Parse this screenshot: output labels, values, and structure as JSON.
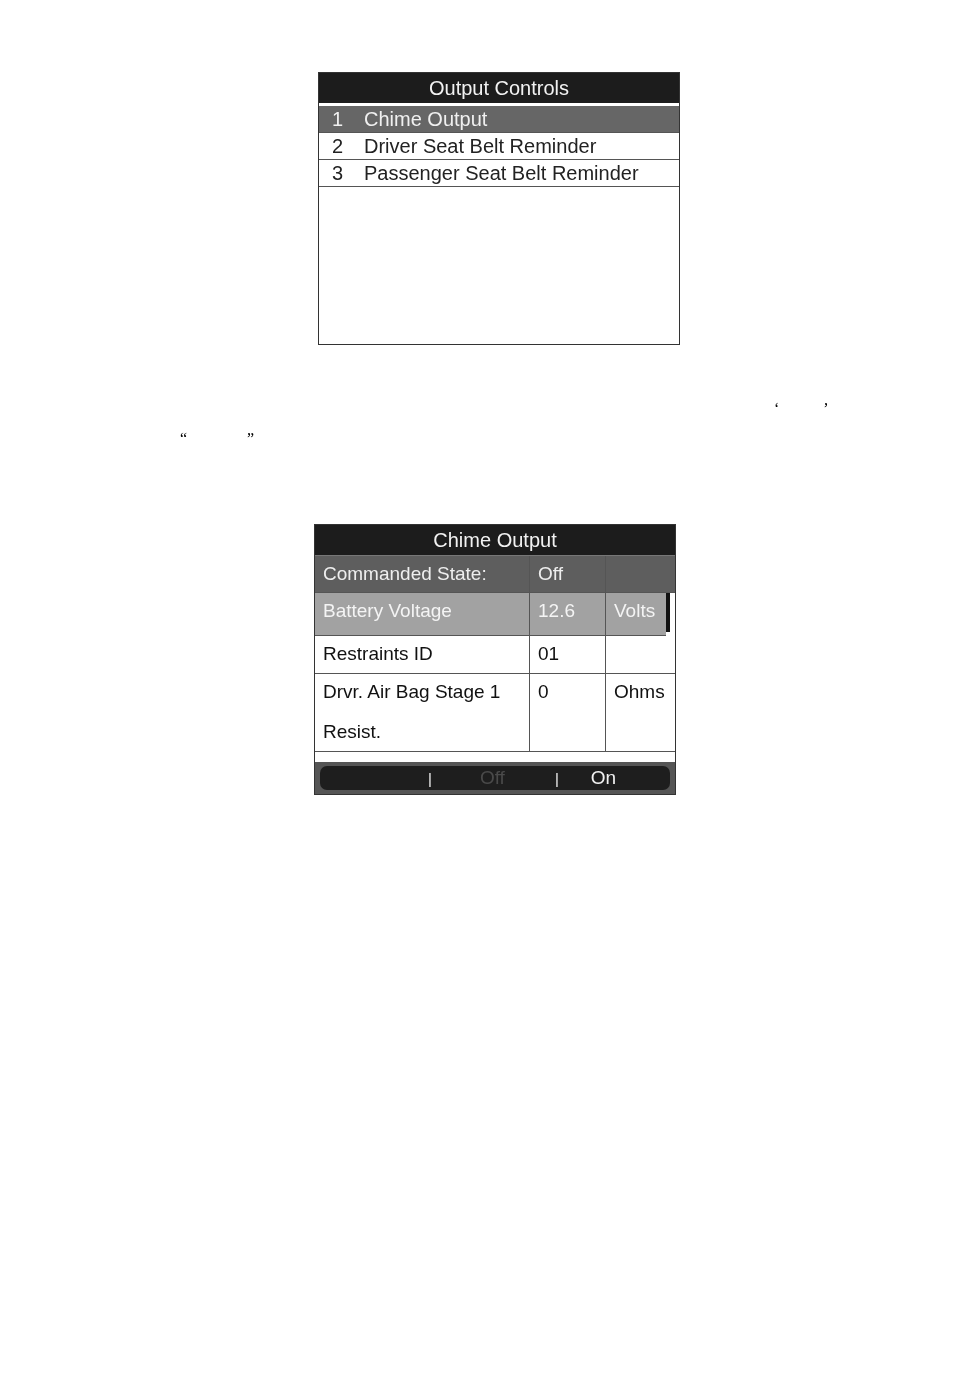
{
  "output_controls_screen": {
    "title": "Output Controls",
    "items": [
      {
        "number": "1",
        "label": "Chime Output",
        "selected": true
      },
      {
        "number": "2",
        "label": "Driver Seat Belt Reminder",
        "selected": false
      },
      {
        "number": "3",
        "label": "Passenger Seat Belt Reminder",
        "selected": false
      }
    ]
  },
  "stray_marks": [
    {
      "left": "‘",
      "right": "’"
    },
    {
      "left": "“",
      "right": "”"
    }
  ],
  "chime_output_screen": {
    "title": "Chime Output",
    "rows": [
      {
        "kind": "header",
        "label": "Commanded State:",
        "value": "Off",
        "selected": false
      },
      {
        "kind": "data",
        "label": "Battery Voltage",
        "value": "12.6",
        "unit": "Volts",
        "selected": true
      },
      {
        "kind": "data",
        "label": "Restraints ID",
        "value": "01",
        "selected": false
      },
      {
        "kind": "data",
        "label": "Drvr. Air Bag Stage 1 Resist.",
        "value": "0",
        "unit": "Ohms",
        "selected": false
      }
    ],
    "softkeys": [
      {
        "separator": "|",
        "label": "Off",
        "disabled": true
      },
      {
        "separator": "|",
        "label": "On",
        "disabled": false
      }
    ]
  }
}
